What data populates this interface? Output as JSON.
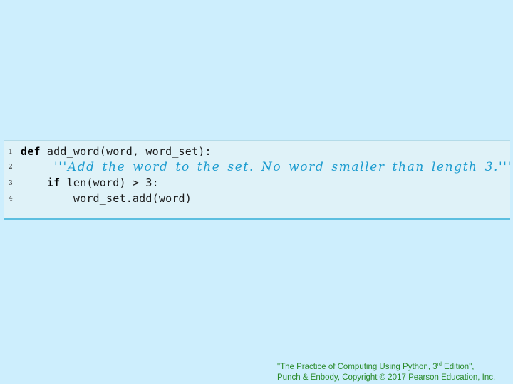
{
  "code": {
    "lines": [
      {
        "num": "1",
        "keyword": "def",
        "text": " add_word(word, word_set):"
      },
      {
        "num": "2",
        "docstring": "'''Add the word to the set. No word smaller than length 3.'''"
      },
      {
        "num": "3",
        "indent": "    ",
        "keyword": "if",
        "text": " len(word) > 3:"
      },
      {
        "num": "4",
        "indent": "        ",
        "text": "word_set.add(word)"
      }
    ]
  },
  "footer": {
    "line1_prefix": "\"The Practice of Computing Using Python, 3",
    "line1_sup": "rd",
    "line1_suffix": " Edition\",",
    "line2": "Punch & Enbody, Copyright © 2017 Pearson Education, Inc."
  },
  "colors": {
    "background": "#cdeefd",
    "code_background": "#dff2f8",
    "docstring": "#1a9bcf",
    "footer_text": "#2a8a2a",
    "code_border": "#5cbfe0"
  }
}
